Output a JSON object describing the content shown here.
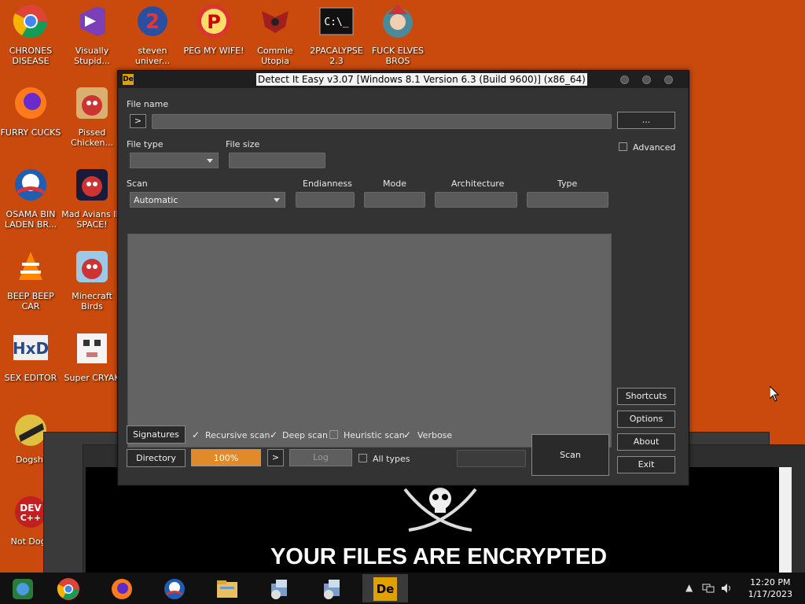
{
  "desktop": {
    "icons": [
      {
        "label": "CHRONES DISEASE",
        "icon": "chrome-icon"
      },
      {
        "label": "Visually Stupid...",
        "icon": "visual-studio-icon"
      },
      {
        "label": "steven univer...",
        "icon": "steven-universe-icon"
      },
      {
        "label": "PEG MY WIFE!",
        "icon": "p-logo-icon"
      },
      {
        "label": "Commie Utopia",
        "icon": "crest-icon"
      },
      {
        "label": "2PACALYPSE 2.3",
        "icon": "terminal-icon"
      },
      {
        "label": "FUCK ELVES BROS",
        "icon": "elf-icon"
      },
      {
        "label": "FURRY CUCKS",
        "icon": "firefox-icon"
      },
      {
        "label": "Pissed Chicken...",
        "icon": "angry-birds-seasons-icon"
      },
      {
        "label": "OSAMA BIN LADEN BR...",
        "icon": "obama-logo-icon"
      },
      {
        "label": "Mad Avians IN SPACE!",
        "icon": "angry-birds-space-icon"
      },
      {
        "label": "BEEP BEEP CAR",
        "icon": "vlc-icon"
      },
      {
        "label": "Minecraft Birds",
        "icon": "angry-birds-icon"
      },
      {
        "label": "SEX EDITOR",
        "icon": "hxd-icon"
      },
      {
        "label": "Super CRYAK",
        "icon": "pixel-dog-icon"
      },
      {
        "label": "Dogshi",
        "icon": "dogshit-icon"
      },
      {
        "label": "Not Dogs",
        "icon": "devcpp-icon"
      }
    ]
  },
  "ransom": {
    "title": "YOUR FILES ARE ENCRYPTED"
  },
  "die": {
    "title": "Detect It Easy v3.07 [Windows 8.1 Version 6.3 (Build 9600)] (x86_64)",
    "file_name_label": "File name",
    "run_arrow": ">",
    "browse_button": "...",
    "file_type_label": "File type",
    "file_size_label": "File size",
    "advanced_label": "Advanced",
    "scan_label": "Scan",
    "scan_mode_value": "Automatic",
    "endianness_label": "Endianness",
    "mode_label": "Mode",
    "architecture_label": "Architecture",
    "type_label": "Type",
    "signatures_button": "Signatures",
    "recursive_scan_label": "Recursive scan",
    "deep_scan_label": "Deep scan",
    "heuristic_scan_label": "Heuristic scan",
    "verbose_label": "Verbose",
    "directory_button": "Directory",
    "progress_text": "100%",
    "progress_fraction": 1.0,
    "next_arrow": ">",
    "log_button": "Log",
    "all_types_label": "All types",
    "scan_button": "Scan",
    "shortcuts_button": "Shortcuts",
    "options_button": "Options",
    "about_button": "About",
    "exit_button": "Exit",
    "check_mark": "✓"
  },
  "taskbar": {
    "time": "12:20 PM",
    "date": "1/17/2023"
  },
  "colors": {
    "desktop": "#c94a0c",
    "progress": "#e08a2a"
  }
}
